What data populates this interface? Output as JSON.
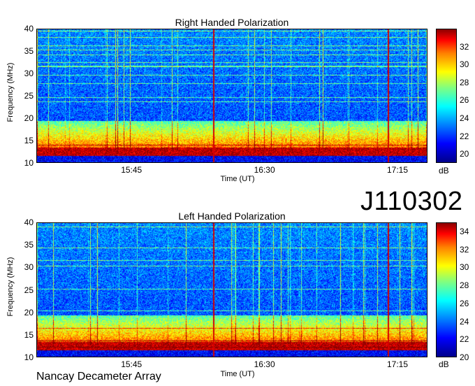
{
  "observation_id": "J110302",
  "observatory": "Nancay Decameter Array",
  "colors": {
    "colormap": [
      "#00008b",
      "#0000ff",
      "#0080ff",
      "#00ffff",
      "#80ff80",
      "#ffff00",
      "#ff8000",
      "#ff0000",
      "#8b0000"
    ]
  },
  "chart_data": [
    {
      "type": "heatmap",
      "title": "Right Handed Polarization",
      "xlabel": "Time (UT)",
      "ylabel": "Frequency (MHz)",
      "x_ticks": [
        "15:45",
        "16:30",
        "17:15"
      ],
      "y_ticks": [
        10,
        15,
        20,
        25,
        30,
        35,
        40
      ],
      "ylim": [
        10,
        40
      ],
      "colorbar": {
        "label": "dB",
        "ticks": [
          20,
          22,
          24,
          26,
          28,
          30,
          32
        ],
        "range": [
          19,
          34
        ]
      }
    },
    {
      "type": "heatmap",
      "title": "Left Handed Polarization",
      "xlabel": "Time (UT)",
      "ylabel": "Frequency (MHz)",
      "x_ticks": [
        "15:45",
        "16:30",
        "17:15"
      ],
      "y_ticks": [
        10,
        15,
        20,
        25,
        30,
        35,
        40
      ],
      "ylim": [
        10,
        40
      ],
      "colorbar": {
        "label": "dB",
        "ticks": [
          20,
          22,
          24,
          26,
          28,
          30,
          32,
          34
        ],
        "range": [
          20,
          35
        ]
      }
    }
  ]
}
